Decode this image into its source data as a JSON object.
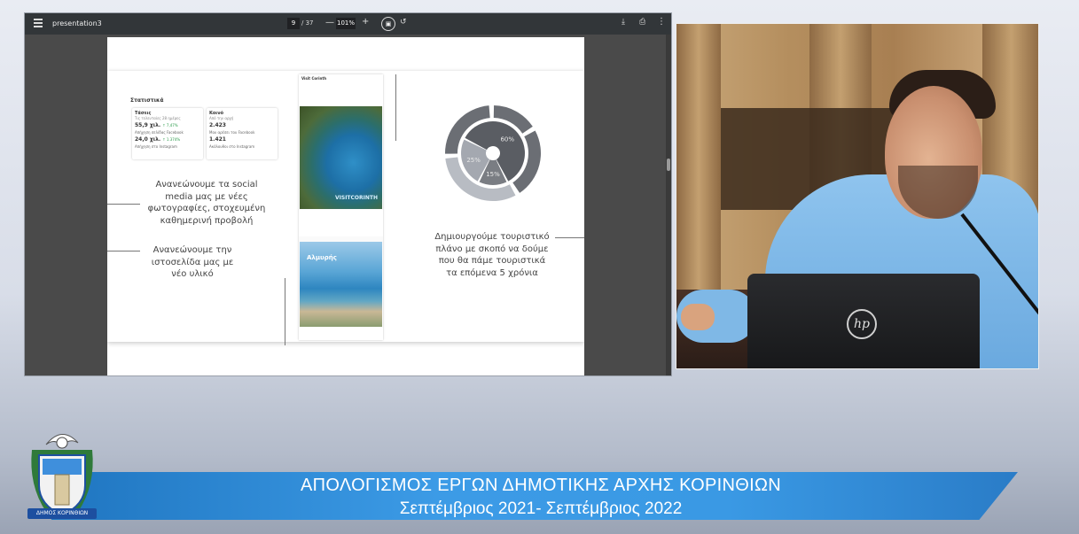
{
  "viewer": {
    "title": "presentation3",
    "page_current": "9",
    "page_total": "/ 37",
    "zoom": "101%",
    "icons": {
      "menu": "menu-icon",
      "minus": "zoom-out-icon",
      "plus": "zoom-in-icon",
      "fit": "fit-page-icon",
      "rotate": "rotate-icon",
      "download": "download-icon",
      "print": "print-icon",
      "more": "more-vert-icon"
    }
  },
  "slide": {
    "stats": {
      "title": "Στατιστικά",
      "card1": {
        "heading": "Τάσεις",
        "sub": "Τις τελευταίες 28 ημέρες",
        "value1": "55,9 χιλ.",
        "delta1": "↑ 7,47%",
        "note1": "Απήχηση σελίδας Facebook",
        "value2": "24,0 χιλ.",
        "delta2": "↑ 1.374%",
        "note2": "Απήχηση στο Instagram"
      },
      "card2": {
        "heading": "Κοινό",
        "sub": "Από την αρχή",
        "value1": "2.423",
        "note1": "Μου αρέσει του Facebook",
        "value2": "1.421",
        "note2": "Ακόλουθοι στο Instagram"
      }
    },
    "text_social": "Ανανεώνουμε τα social media μας με νέες φωτογραφίες, στοχευμένη καθημερινή προβολή",
    "text_website": "Ανανεώνουμε την ιστοσελίδα μας με νέο υλικό",
    "text_plan": "Δημιουργούμε τουριστικό πλάνο με σκοπό να δούμε που θα πάμε τουριστικά τα επόμενα 5 χρόνια",
    "post": {
      "author": "Visit Corinth",
      "photo1_caption": "VISITCORINTH",
      "photo2_caption": "Αλμυρής"
    }
  },
  "chart_data": {
    "type": "pie",
    "categories": [
      "60%",
      "15%",
      "25%"
    ],
    "values": [
      60,
      15,
      25
    ],
    "colors": [
      "#5a5d63",
      "#7a7d83",
      "#a4a8b0"
    ],
    "ring_color": "#6b6e74",
    "ring_gap_color": "#b8bcc3"
  },
  "camera": {
    "logo": "hp-logo"
  },
  "lower_third": {
    "line1": "ΑΠΟΛΟΓΙΣΜΟΣ  ΕΡΓΩΝ ΔΗΜΟΤΙΚΗΣ ΑΡΧΗΣ ΚΟΡΙΝΘΙΩΝ",
    "line2": "Σεπτέμβριος 2021- Σεπτέμβριος 2022",
    "crest_label": "ΔΗΜΟΣ ΚΟΡΙΝΘΙΩΝ",
    "brand_color": "#3a99e4"
  }
}
